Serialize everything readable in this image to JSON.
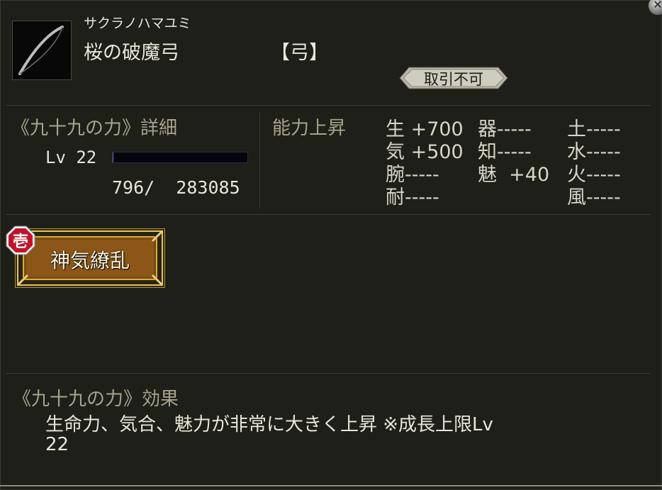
{
  "item": {
    "reading": "サクラノハマユミ",
    "name": "桜の破魔弓",
    "category": "【弓】",
    "trade_status": "取引不可",
    "icon": "bow-icon"
  },
  "level": {
    "title": "《九十九の力》詳細",
    "label": "Lv 22",
    "progress_text": "796/  283085",
    "progress_fraction": 0.0028
  },
  "abilities": {
    "header": "能力上昇",
    "col1": [
      "生 +700",
      "気 +500",
      "腕-----",
      "耐-----"
    ],
    "col2": [
      "器-----",
      "知-----",
      "魅  +40",
      ""
    ],
    "col3": [
      "土-----",
      "水-----",
      "火-----",
      "風-----"
    ]
  },
  "skill": {
    "badge": "壱",
    "name": "神気繚乱"
  },
  "effect": {
    "title": "《九十九の力》効果",
    "line1": "生命力、気合、魅力が非常に大きく上昇 ※成長上限Lv",
    "line2": "22"
  },
  "colors": {
    "background": "#1d1f18",
    "gold": "#c9a13a",
    "badge_red": "#c0142a"
  }
}
